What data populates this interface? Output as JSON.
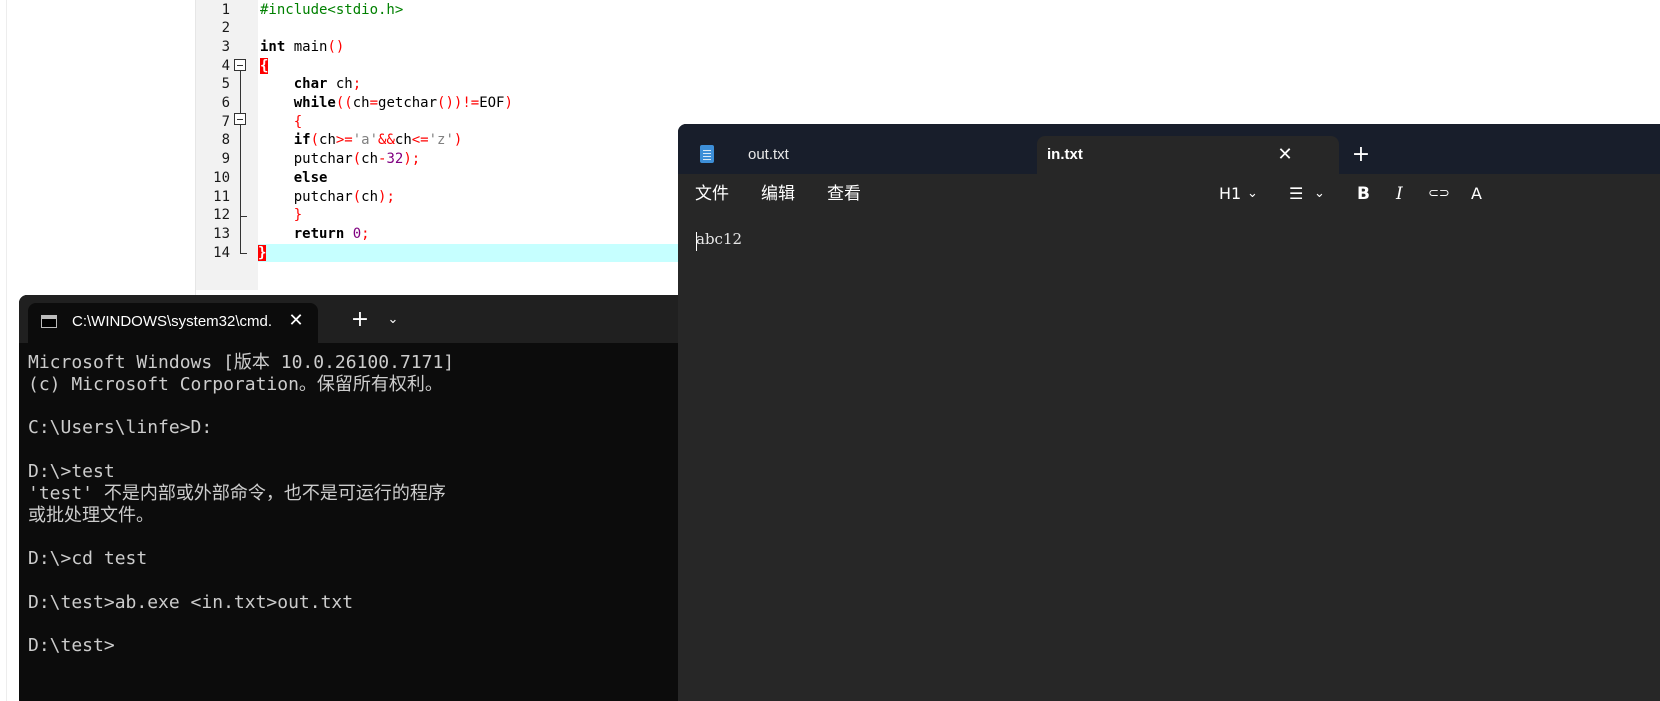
{
  "editor": {
    "line_numbers": [
      "1",
      "2",
      "3",
      "4",
      "5",
      "6",
      "7",
      "8",
      "9",
      "10",
      "11",
      "12",
      "13",
      "14"
    ],
    "code": {
      "l1": "#include<stdio.h>",
      "l3_kw": "int",
      "l3_id": " main",
      "l3_op": "()",
      "l4_brace": "{",
      "l5_kw": "char",
      "l5_id": " ch",
      "l5_op": ";",
      "l6_kw": "while",
      "l6_a": "((",
      "l6_b": "ch",
      "l6_c": "=",
      "l6_d": "getchar",
      "l6_e": "())!=",
      "l6_f": "EOF",
      "l6_g": ")",
      "l7_brace": "{",
      "l8_kw": "if",
      "l8_a": "(",
      "l8_b": "ch",
      "l8_c": ">=",
      "l8_d": "'a'",
      "l8_e": "&&",
      "l8_f": "ch",
      "l8_g": "<=",
      "l8_h": "'z'",
      "l8_i": ")",
      "l9_a": "putchar",
      "l9_b": "(",
      "l9_c": "ch",
      "l9_d": "-",
      "l9_e": "32",
      "l9_f": ");",
      "l10_kw": "else",
      "l11_a": "putchar",
      "l11_b": "(",
      "l11_c": "ch",
      "l11_d": ");",
      "l12_brace": "}",
      "l13_kw": "return",
      "l13_num": " 0",
      "l13_op": ";",
      "l14_brace": "}"
    }
  },
  "terminal": {
    "tab_title": "C:\\WINDOWS\\system32\\cmd.exe",
    "tab_icon": "console-icon",
    "close_glyph": "✕",
    "new_tab_glyph": "+",
    "dropdown_glyph": "⌄",
    "output": "Microsoft Windows [版本 10.0.26100.7171]\n(c) Microsoft Corporation。保留所有权利。\n\nC:\\Users\\linfe>D:\n\nD:\\>test\n'test' 不是内部或外部命令，也不是可运行的程序\n或批处理文件。\n\nD:\\>cd test\n\nD:\\test>ab.exe <in.txt>out.txt\n\nD:\\test>"
  },
  "notepad": {
    "tabs": [
      {
        "label": "out.txt"
      },
      {
        "label": "in.txt"
      }
    ],
    "close_glyph": "✕",
    "new_tab_glyph": "+",
    "menu": [
      "文件",
      "编辑",
      "查看"
    ],
    "toolbar": {
      "heading": "H1",
      "heading_chevron": "⌄",
      "list_icon": "☰",
      "list_chevron": "⌄",
      "bold": "B",
      "italic": "I",
      "link_icon": "⊂⊃",
      "spellcheck": "A"
    },
    "content": "abc12",
    "accent_color": "#3d8fd8"
  }
}
